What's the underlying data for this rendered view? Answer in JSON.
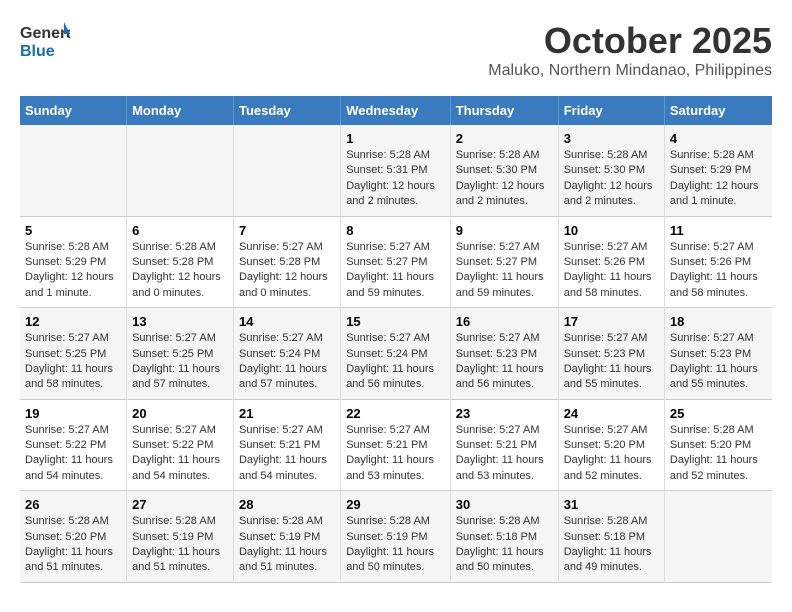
{
  "header": {
    "logo": {
      "line1": "General",
      "line2": "Blue"
    },
    "title": "October 2025",
    "subtitle": "Maluko, Northern Mindanao, Philippines"
  },
  "days_of_week": [
    "Sunday",
    "Monday",
    "Tuesday",
    "Wednesday",
    "Thursday",
    "Friday",
    "Saturday"
  ],
  "weeks": [
    [
      {
        "num": "",
        "info": ""
      },
      {
        "num": "",
        "info": ""
      },
      {
        "num": "",
        "info": ""
      },
      {
        "num": "1",
        "info": "Sunrise: 5:28 AM\nSunset: 5:31 PM\nDaylight: 12 hours\nand 2 minutes."
      },
      {
        "num": "2",
        "info": "Sunrise: 5:28 AM\nSunset: 5:30 PM\nDaylight: 12 hours\nand 2 minutes."
      },
      {
        "num": "3",
        "info": "Sunrise: 5:28 AM\nSunset: 5:30 PM\nDaylight: 12 hours\nand 2 minutes."
      },
      {
        "num": "4",
        "info": "Sunrise: 5:28 AM\nSunset: 5:29 PM\nDaylight: 12 hours\nand 1 minute."
      }
    ],
    [
      {
        "num": "5",
        "info": "Sunrise: 5:28 AM\nSunset: 5:29 PM\nDaylight: 12 hours\nand 1 minute."
      },
      {
        "num": "6",
        "info": "Sunrise: 5:28 AM\nSunset: 5:28 PM\nDaylight: 12 hours\nand 0 minutes."
      },
      {
        "num": "7",
        "info": "Sunrise: 5:27 AM\nSunset: 5:28 PM\nDaylight: 12 hours\nand 0 minutes."
      },
      {
        "num": "8",
        "info": "Sunrise: 5:27 AM\nSunset: 5:27 PM\nDaylight: 11 hours\nand 59 minutes."
      },
      {
        "num": "9",
        "info": "Sunrise: 5:27 AM\nSunset: 5:27 PM\nDaylight: 11 hours\nand 59 minutes."
      },
      {
        "num": "10",
        "info": "Sunrise: 5:27 AM\nSunset: 5:26 PM\nDaylight: 11 hours\nand 58 minutes."
      },
      {
        "num": "11",
        "info": "Sunrise: 5:27 AM\nSunset: 5:26 PM\nDaylight: 11 hours\nand 58 minutes."
      }
    ],
    [
      {
        "num": "12",
        "info": "Sunrise: 5:27 AM\nSunset: 5:25 PM\nDaylight: 11 hours\nand 58 minutes."
      },
      {
        "num": "13",
        "info": "Sunrise: 5:27 AM\nSunset: 5:25 PM\nDaylight: 11 hours\nand 57 minutes."
      },
      {
        "num": "14",
        "info": "Sunrise: 5:27 AM\nSunset: 5:24 PM\nDaylight: 11 hours\nand 57 minutes."
      },
      {
        "num": "15",
        "info": "Sunrise: 5:27 AM\nSunset: 5:24 PM\nDaylight: 11 hours\nand 56 minutes."
      },
      {
        "num": "16",
        "info": "Sunrise: 5:27 AM\nSunset: 5:23 PM\nDaylight: 11 hours\nand 56 minutes."
      },
      {
        "num": "17",
        "info": "Sunrise: 5:27 AM\nSunset: 5:23 PM\nDaylight: 11 hours\nand 55 minutes."
      },
      {
        "num": "18",
        "info": "Sunrise: 5:27 AM\nSunset: 5:23 PM\nDaylight: 11 hours\nand 55 minutes."
      }
    ],
    [
      {
        "num": "19",
        "info": "Sunrise: 5:27 AM\nSunset: 5:22 PM\nDaylight: 11 hours\nand 54 minutes."
      },
      {
        "num": "20",
        "info": "Sunrise: 5:27 AM\nSunset: 5:22 PM\nDaylight: 11 hours\nand 54 minutes."
      },
      {
        "num": "21",
        "info": "Sunrise: 5:27 AM\nSunset: 5:21 PM\nDaylight: 11 hours\nand 54 minutes."
      },
      {
        "num": "22",
        "info": "Sunrise: 5:27 AM\nSunset: 5:21 PM\nDaylight: 11 hours\nand 53 minutes."
      },
      {
        "num": "23",
        "info": "Sunrise: 5:27 AM\nSunset: 5:21 PM\nDaylight: 11 hours\nand 53 minutes."
      },
      {
        "num": "24",
        "info": "Sunrise: 5:27 AM\nSunset: 5:20 PM\nDaylight: 11 hours\nand 52 minutes."
      },
      {
        "num": "25",
        "info": "Sunrise: 5:28 AM\nSunset: 5:20 PM\nDaylight: 11 hours\nand 52 minutes."
      }
    ],
    [
      {
        "num": "26",
        "info": "Sunrise: 5:28 AM\nSunset: 5:20 PM\nDaylight: 11 hours\nand 51 minutes."
      },
      {
        "num": "27",
        "info": "Sunrise: 5:28 AM\nSunset: 5:19 PM\nDaylight: 11 hours\nand 51 minutes."
      },
      {
        "num": "28",
        "info": "Sunrise: 5:28 AM\nSunset: 5:19 PM\nDaylight: 11 hours\nand 51 minutes."
      },
      {
        "num": "29",
        "info": "Sunrise: 5:28 AM\nSunset: 5:19 PM\nDaylight: 11 hours\nand 50 minutes."
      },
      {
        "num": "30",
        "info": "Sunrise: 5:28 AM\nSunset: 5:18 PM\nDaylight: 11 hours\nand 50 minutes."
      },
      {
        "num": "31",
        "info": "Sunrise: 5:28 AM\nSunset: 5:18 PM\nDaylight: 11 hours\nand 49 minutes."
      },
      {
        "num": "",
        "info": ""
      }
    ]
  ]
}
